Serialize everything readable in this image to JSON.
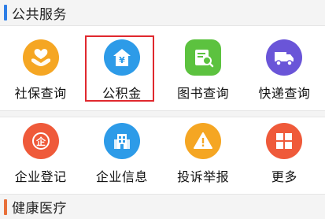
{
  "sections": [
    {
      "title": "公共服务",
      "accent_color": "#2f7fe6"
    },
    {
      "title": "健康医疗",
      "accent_color": "#e8703a"
    }
  ],
  "row1": [
    {
      "label": "社保查询",
      "icon": "hands-heart-icon",
      "color": "#f5a623"
    },
    {
      "label": "公积金",
      "icon": "house-yen-icon",
      "color": "#2d9be8"
    },
    {
      "label": "图书查询",
      "icon": "book-search-icon",
      "color": "#5cc23f"
    },
    {
      "label": "快递查询",
      "icon": "truck-icon",
      "color": "#6a55d8"
    }
  ],
  "row2": [
    {
      "label": "企业登记",
      "icon": "enterprise-badge-icon",
      "color": "#ef5a3a"
    },
    {
      "label": "企业信息",
      "icon": "building-icon",
      "color": "#2d9be8"
    },
    {
      "label": "投诉举报",
      "icon": "warning-icon",
      "color": "#f5a623"
    },
    {
      "label": "更多",
      "icon": "more-grid-icon",
      "color": "#ef5a3a"
    }
  ]
}
